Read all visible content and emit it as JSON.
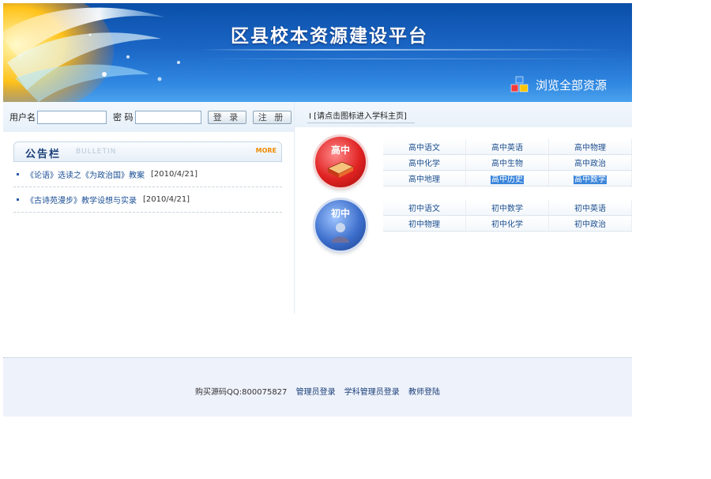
{
  "banner": {
    "title": "区县校本资源建设平台",
    "browse_all": "浏览全部资源",
    "icon": "cubes-icon"
  },
  "login": {
    "username_label": "用户名",
    "username_value": "",
    "password_label": "密 码",
    "password_value": "",
    "login_button": "登 录",
    "register_button": "注 册"
  },
  "bulletin": {
    "title": "公告栏",
    "subtitle": "BULLETIN",
    "more": "MORE",
    "items": [
      {
        "title": "《论语》选读之《为政治国》教案",
        "date": "[2010/4/21]"
      },
      {
        "title": "《古诗苑漫步》教学设想与实录",
        "date": "[2010/4/21]"
      }
    ]
  },
  "subjects": {
    "hint": "请点击图标进入学科主页",
    "high": {
      "badge": "高中",
      "rows": [
        [
          "高中语文",
          "高中英语",
          "高中物理"
        ],
        [
          "高中化学",
          "高中生物",
          "高中政治"
        ],
        [
          "高中地理",
          "高中历史",
          "高中数学"
        ]
      ]
    },
    "middle": {
      "badge": "初中",
      "rows": [
        [
          "初中语文",
          "初中数学",
          "初中英语"
        ],
        [
          "初中物理",
          "初中化学",
          "初中政治"
        ]
      ]
    }
  },
  "footer": {
    "purchase": "购买源码QQ:800075827",
    "links": [
      "管理员登录",
      "学科管理员登录",
      "教师登陆"
    ]
  },
  "colors": {
    "banner_blue": "#1b66c5",
    "link_blue": "#1b4f95",
    "more_orange": "#f08a00",
    "footer_bg": "#eef2fb"
  }
}
